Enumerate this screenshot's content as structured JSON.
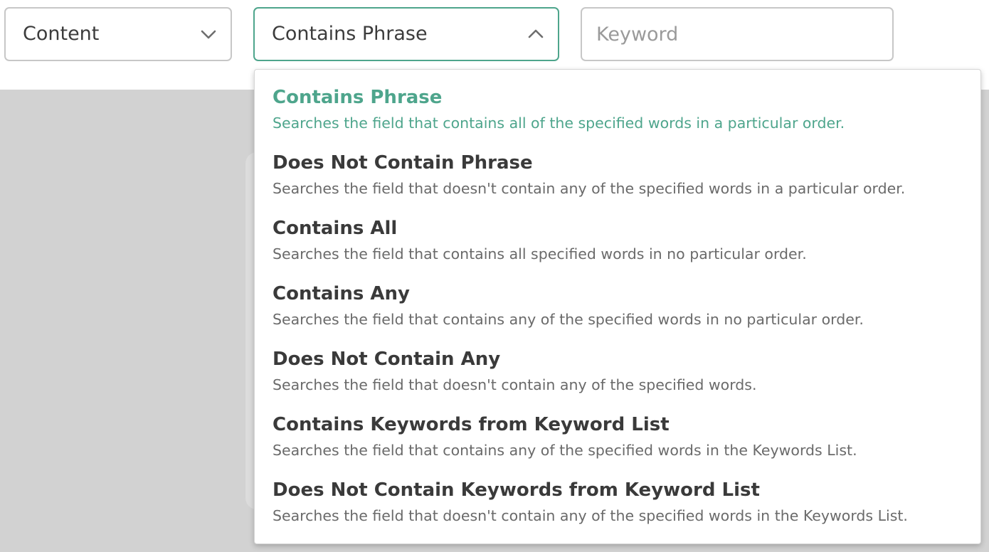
{
  "filters": {
    "field_select": {
      "value": "Content"
    },
    "match_select": {
      "value": "Contains Phrase",
      "expanded": true
    },
    "keyword_input": {
      "value": "",
      "placeholder": "Keyword"
    }
  },
  "dropdown": {
    "options": [
      {
        "title": "Contains Phrase",
        "description": "Searches the field that contains all of the specified words in a particular order.",
        "selected": true
      },
      {
        "title": "Does Not Contain Phrase",
        "description": "Searches the field that doesn't contain any of the specified words in a particular order.",
        "selected": false
      },
      {
        "title": "Contains All",
        "description": "Searches the field that contains all specified words in no particular order.",
        "selected": false
      },
      {
        "title": "Contains Any",
        "description": "Searches the field that contains any of the specified words in no particular order.",
        "selected": false
      },
      {
        "title": "Does Not Contain Any",
        "description": "Searches the field that doesn't contain any of the specified words.",
        "selected": false
      },
      {
        "title": "Contains Keywords from Keyword List",
        "description": "Searches the field that contains any of the specified words in the Keywords List.",
        "selected": false
      },
      {
        "title": "Does Not Contain Keywords from Keyword List",
        "description": "Searches the field that doesn't contain any of the specified words in the Keywords List.",
        "selected": false
      }
    ]
  },
  "icons": {
    "field_chevron": "chevron-down-icon",
    "match_chevron": "chevron-up-icon"
  },
  "colors": {
    "accent": "#4ea58c",
    "text": "#3a3a3a",
    "muted_text": "#6a6a6a",
    "placeholder": "#9a9a9a",
    "border": "#c7c7c7",
    "backdrop": "#d2d2d2"
  }
}
